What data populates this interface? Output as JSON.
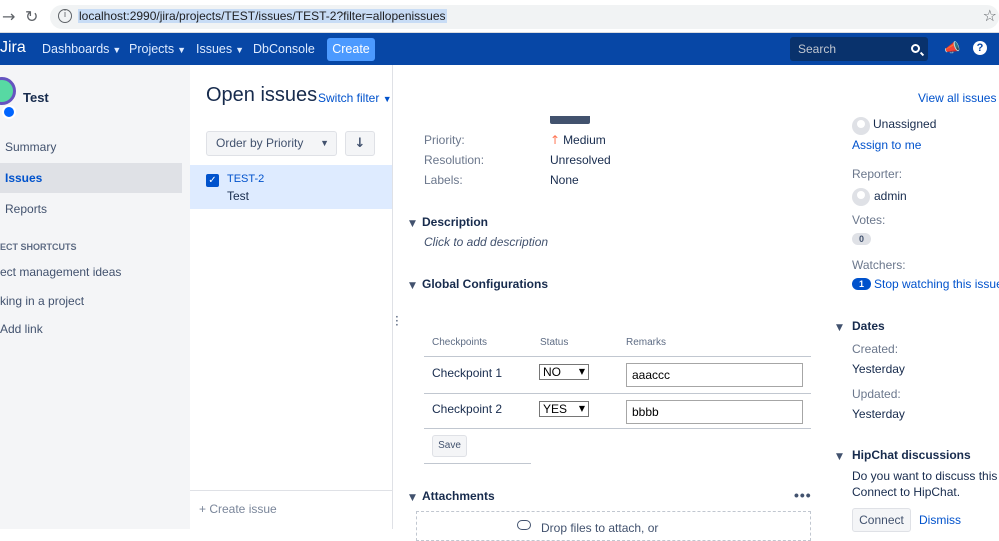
{
  "browser": {
    "back_icon": "back-arrow-icon",
    "reload_icon": "reload-icon",
    "url": "localhost:2990/jira/projects/TEST/issues/TEST-2?filter=allopenissues"
  },
  "topnav": {
    "logo": "Jira",
    "menus": [
      "Dashboards",
      "Projects",
      "Issues"
    ],
    "dbconsole": "DbConsole",
    "create": "Create",
    "search_placeholder": "Search",
    "brand_color": "#0747a6"
  },
  "sidebar": {
    "project_name": "Test",
    "items": [
      {
        "label": "Summary"
      },
      {
        "label": "Issues"
      },
      {
        "label": "Reports"
      }
    ],
    "section_title": "ECT SHORTCUTS",
    "links": [
      "ect management ideas",
      "king in a project",
      "Add link"
    ]
  },
  "issues_panel": {
    "title": "Open issues",
    "switch_filter": "Switch filter",
    "view_all": "View all issues ar",
    "order_by": "Order by Priority",
    "selected_issue": {
      "key": "TEST-2",
      "summary": "Test"
    },
    "create_issue": "+ Create issue"
  },
  "details": {
    "fields": [
      {
        "label": "Priority:",
        "value": "Medium"
      },
      {
        "label": "Resolution:",
        "value": "Unresolved"
      },
      {
        "label": "Labels:",
        "value": "None"
      }
    ],
    "description": {
      "heading": "Description",
      "placeholder": "Click to add description"
    },
    "global_config": {
      "heading": "Global Configurations",
      "headers": [
        "Checkpoints",
        "Status",
        "Remarks"
      ],
      "rows": [
        {
          "checkpoint": "Checkpoint 1",
          "status": "NO",
          "remarks": "aaaccc"
        },
        {
          "checkpoint": "Checkpoint 2",
          "status": "YES",
          "remarks": "bbbb"
        }
      ],
      "save": "Save"
    },
    "attachments": {
      "heading": "Attachments",
      "more": "•••",
      "drop_text": "Drop files to attach, or"
    }
  },
  "people": {
    "assignee": "Unassigned",
    "assign_to_me": "Assign to me",
    "reporter_label": "Reporter:",
    "reporter": "admin",
    "votes_label": "Votes:",
    "votes": "0",
    "watchers_label": "Watchers:",
    "watchers": "1",
    "stop_watching": "Stop watching this issue"
  },
  "dates": {
    "heading": "Dates",
    "created_label": "Created:",
    "created": "Yesterday",
    "updated_label": "Updated:",
    "updated": "Yesterday"
  },
  "hipchat": {
    "heading": "HipChat discussions",
    "text1": "Do you want to discuss this is",
    "text2": "Connect to HipChat.",
    "connect": "Connect",
    "dismiss": "Dismiss"
  }
}
